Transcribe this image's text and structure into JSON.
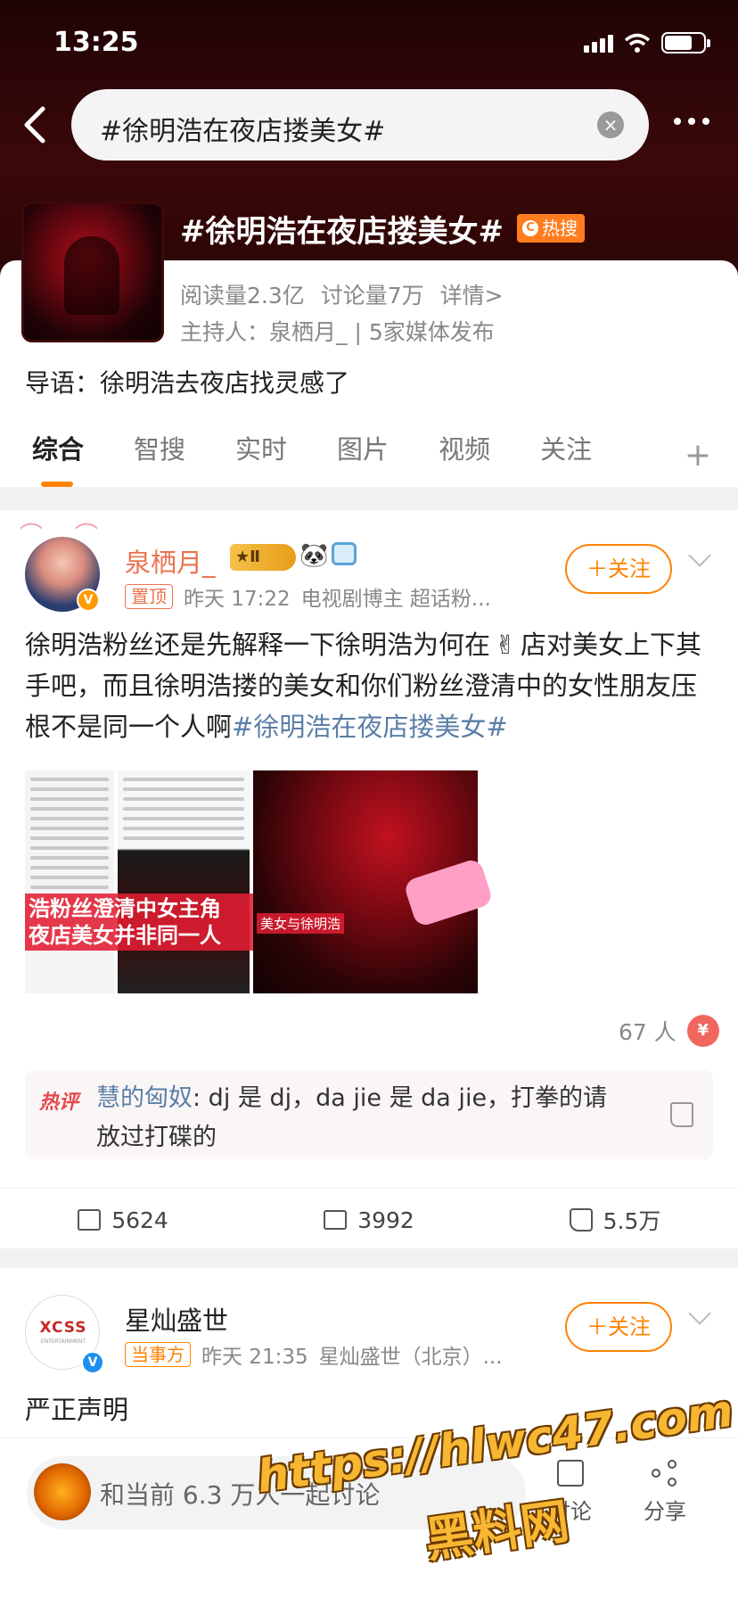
{
  "status_bar": {
    "time": "13:25"
  },
  "search": {
    "query": "#徐明浩在夜店搂美女#",
    "clear_glyph": "×"
  },
  "topic": {
    "title": "#徐明浩在夜店搂美女#",
    "hot_badge": "热搜",
    "hot_badge_icon": "C",
    "reads": "阅读量2.3亿",
    "discussions": "讨论量7万",
    "details": "详情>",
    "host": "主持人：泉栖月_ | 5家媒体发布",
    "lead": "导语：徐明浩去夜店找灵感了"
  },
  "tabs": [
    "综合",
    "智搜",
    "实时",
    "图片",
    "视频",
    "关注"
  ],
  "tabs_more": "+",
  "post1": {
    "author": "泉栖月_",
    "medal": "Ⅱ",
    "emoji": "🐼",
    "pin_tag": "置顶",
    "time": "昨天 17:22",
    "source": "电视剧博主 超话粉...",
    "follow": "＋关注",
    "text_part1": "徐明浩粉丝还是先解释一下徐明浩为何在",
    "peace_emoji": "✌",
    "text_part2": "店对美女上下其手吧，而且徐明浩搂的美女和你们粉丝澄清中的女性朋友压根不是同一个人啊",
    "hashtag": "#徐明浩在夜店搂美女#",
    "image_caption": "浩粉丝澄清中女主角\n夜店美女并非同一人",
    "image_small_caption": "美女与徐明浩",
    "reward_count": "67 人",
    "reward_icon": "¥",
    "hot_comment_label": "热评",
    "hot_comment_user": "慧的匈奴",
    "hot_comment_text": ": dj 是 dj，da jie 是 da jie，打拳的请放过打碟的",
    "reposts": "5624",
    "comments": "3992",
    "likes": "5.5万"
  },
  "post2": {
    "author": "星灿盛世",
    "avatar_logo": "XCSS",
    "avatar_sub": "ENTERTAINMENT",
    "party_tag": "当事方",
    "time": "昨天 21:35",
    "source": "星灿盛世（北京）...",
    "follow": "＋关注",
    "text": "严正声明"
  },
  "bottom_bar": {
    "discuss_placeholder": "和当前 6.3 万人一起讨论",
    "comment_label": "讨论",
    "share_label": "分享"
  },
  "watermark": {
    "line1": "https://hlwc47.com",
    "line2": "黑料网"
  },
  "colors": {
    "accent": "#ff8200",
    "username": "#eb7350",
    "link": "#5b7ea8",
    "hot": "#e5484d"
  }
}
